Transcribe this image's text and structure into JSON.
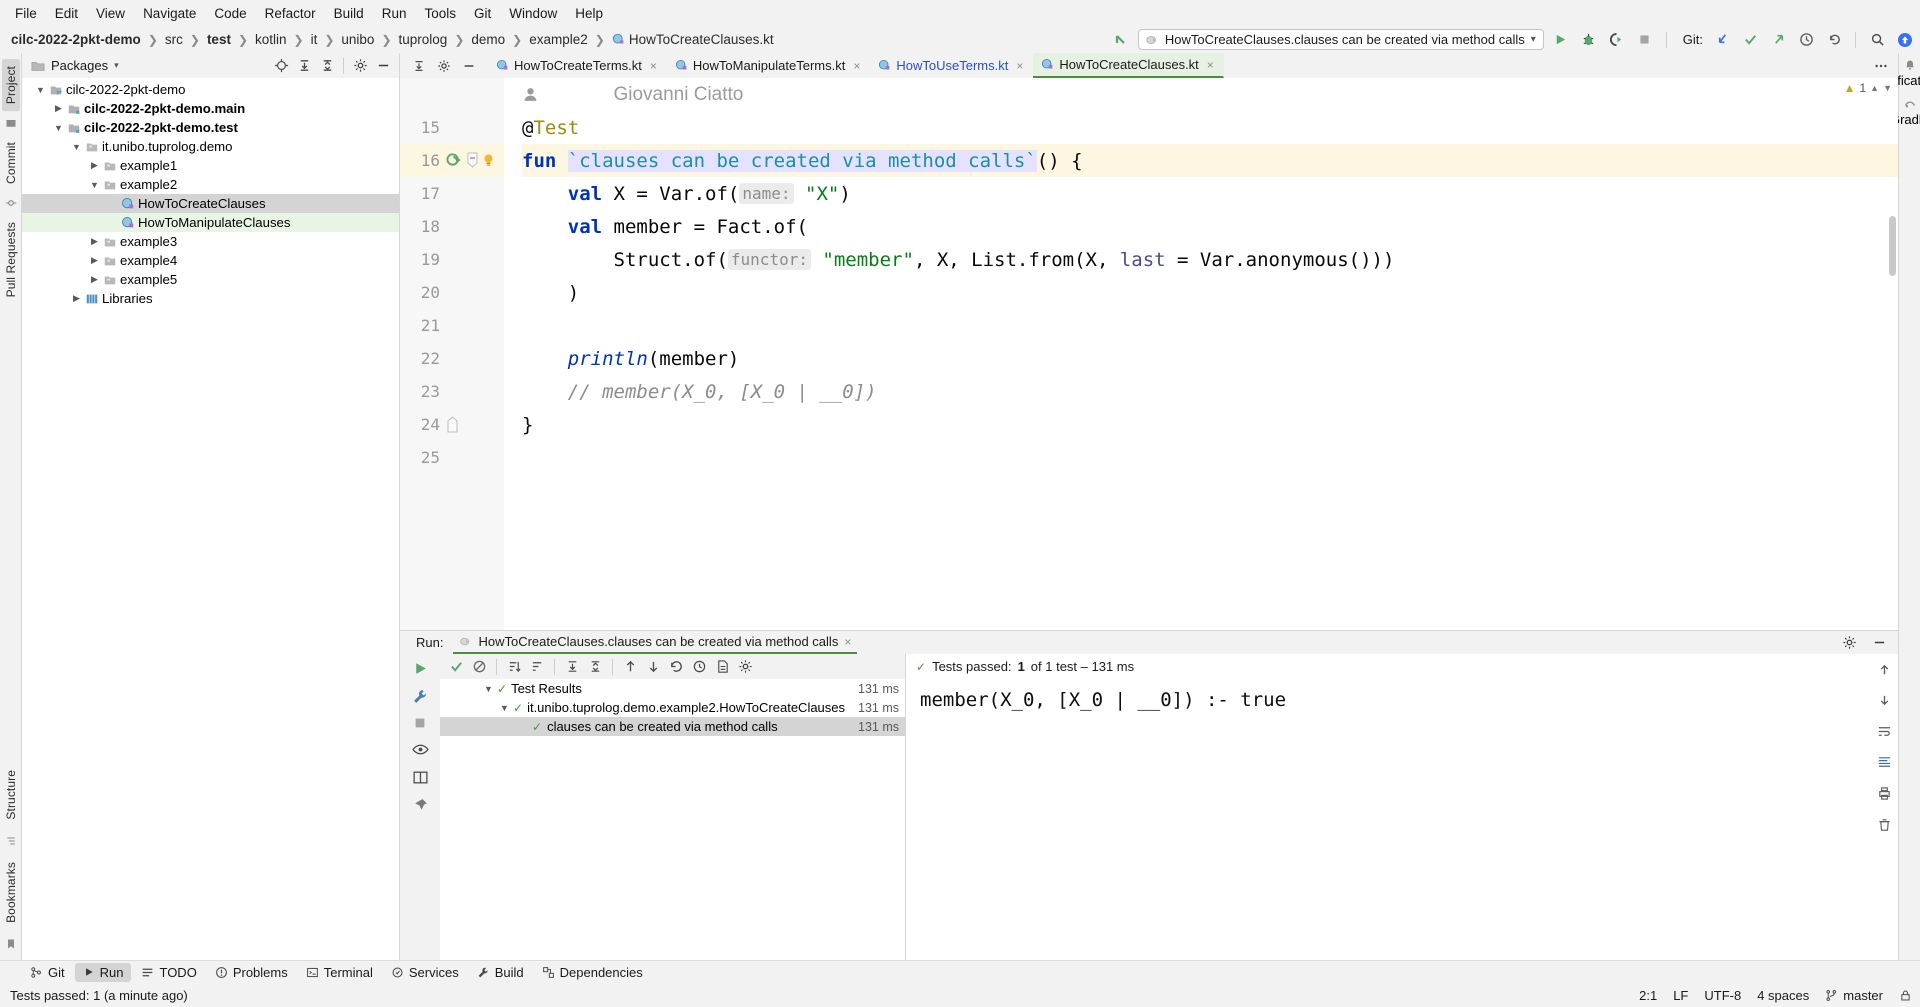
{
  "menu": {
    "items": [
      "File",
      "Edit",
      "View",
      "Navigate",
      "Code",
      "Refactor",
      "Build",
      "Run",
      "Tools",
      "Git",
      "Window",
      "Help"
    ]
  },
  "breadcrumb": {
    "items": [
      {
        "label": "cilc-2022-2pkt-demo",
        "bold": true,
        "icon": ""
      },
      {
        "label": "src",
        "bold": false,
        "icon": ""
      },
      {
        "label": "test",
        "bold": true,
        "icon": ""
      },
      {
        "label": "kotlin",
        "bold": false,
        "icon": ""
      },
      {
        "label": "it",
        "bold": false,
        "icon": ""
      },
      {
        "label": "unibo",
        "bold": false,
        "icon": ""
      },
      {
        "label": "tuprolog",
        "bold": false,
        "icon": ""
      },
      {
        "label": "demo",
        "bold": false,
        "icon": ""
      },
      {
        "label": "example2",
        "bold": false,
        "icon": ""
      },
      {
        "label": "HowToCreateClauses.kt",
        "bold": false,
        "icon": "kotlin-class-icon"
      }
    ],
    "separator": "❯"
  },
  "toolbar": {
    "run_config": "HowToCreateClauses.clauses can be created via method calls",
    "run_config_icon": "test-run-icon",
    "dropdown_glyph": "▾",
    "run_button": "run-icon",
    "debug_button": "debug-icon",
    "coverage_button": "run-with-coverage-icon",
    "stop_button": "stop-icon",
    "git_label": "Git:",
    "git_update": "update-project-icon",
    "git_commit": "commit-icon",
    "git_push": "push-icon",
    "history": "history-icon",
    "rollback": "rollback-icon",
    "search": "search-everywhere-icon",
    "updates": "ide-update-icon",
    "back_arrow": "back-arrow-icon"
  },
  "left_rail": {
    "top": [
      "Project",
      "Commit",
      "Pull Requests"
    ],
    "bottom": [
      "Bookmarks",
      "Structure"
    ],
    "selected": "Project"
  },
  "right_rail": {
    "items": [
      "Notifications",
      "Gradle"
    ]
  },
  "project_panel": {
    "title": "Packages",
    "title_icon": "packages-icon",
    "dropdown_glyph": "▾",
    "actions": [
      "locate-icon",
      "expand-all-icon",
      "collapse-all-icon",
      "settings-icon",
      "hide-icon"
    ],
    "tree": [
      {
        "depth": 0,
        "arrow": "down",
        "icon": "module-icon",
        "label": "cilc-2022-2pkt-demo",
        "bold": false,
        "state": "none"
      },
      {
        "depth": 1,
        "arrow": "right",
        "icon": "source-icon",
        "label": "cilc-2022-2pkt-demo.main",
        "bold": true,
        "state": "none"
      },
      {
        "depth": 1,
        "arrow": "down",
        "icon": "source-icon",
        "label": "cilc-2022-2pkt-demo.test",
        "bold": true,
        "state": "none"
      },
      {
        "depth": 2,
        "arrow": "down",
        "icon": "package-icon",
        "label": "it.unibo.tuprolog.demo",
        "bold": false,
        "state": "none"
      },
      {
        "depth": 3,
        "arrow": "right",
        "icon": "package-icon",
        "label": "example1",
        "bold": false,
        "state": "none"
      },
      {
        "depth": 3,
        "arrow": "down",
        "icon": "package-icon",
        "label": "example2",
        "bold": false,
        "state": "none"
      },
      {
        "depth": 4,
        "arrow": "none",
        "icon": "kotlin-class-icon",
        "label": "HowToCreateClauses",
        "bold": false,
        "state": "sel-gray"
      },
      {
        "depth": 4,
        "arrow": "none",
        "icon": "kotlin-class-icon",
        "label": "HowToManipulateClauses",
        "bold": false,
        "state": "sel-green"
      },
      {
        "depth": 3,
        "arrow": "right",
        "icon": "package-icon",
        "label": "example3",
        "bold": false,
        "state": "none"
      },
      {
        "depth": 3,
        "arrow": "right",
        "icon": "package-icon",
        "label": "example4",
        "bold": false,
        "state": "none"
      },
      {
        "depth": 3,
        "arrow": "right",
        "icon": "package-icon",
        "label": "example5",
        "bold": false,
        "state": "none"
      },
      {
        "depth": 1,
        "arrow": "right",
        "icon": "library-icon",
        "label": "Libraries",
        "bold": false,
        "state": "none"
      }
    ]
  },
  "editor": {
    "tabs": [
      {
        "label": "HowToCreateTerms.kt",
        "active": false,
        "blue": false
      },
      {
        "label": "HowToManipulateTerms.kt",
        "active": false,
        "blue": false
      },
      {
        "label": "HowToUseTerms.kt",
        "active": false,
        "blue": true
      },
      {
        "label": "HowToCreateClauses.kt",
        "active": true,
        "blue": false
      }
    ],
    "close_glyph": "×",
    "inspection_count": "1",
    "inspection_glyph": "⚠",
    "author_annotation": "Giovanni Ciatto",
    "lines": [
      {
        "num": "",
        "highlight": false,
        "gutter": [],
        "type": "author",
        "text": "Giovanni Ciatto"
      },
      {
        "num": "15",
        "highlight": false,
        "gutter": [],
        "type": "code",
        "tokens": [
          {
            "t": "@",
            "c": "plain"
          },
          {
            "t": "Test",
            "c": "ann"
          }
        ]
      },
      {
        "num": "16",
        "highlight": true,
        "gutter": [
          "run-test-gutter-icon",
          "fold-icon",
          "bulb-icon"
        ],
        "type": "code",
        "tokens": [
          {
            "t": "fun ",
            "c": "kw"
          },
          {
            "t": "`clauses can be created via method calls`",
            "c": "fname sel"
          },
          {
            "t": "() {",
            "c": "plain"
          }
        ]
      },
      {
        "num": "17",
        "highlight": false,
        "gutter": [],
        "type": "code",
        "tokens": [
          {
            "t": "    ",
            "c": "plain"
          },
          {
            "t": "val ",
            "c": "kw"
          },
          {
            "t": "X = Var.of(",
            "c": "plain"
          },
          {
            "t": "name:",
            "c": "hint"
          },
          {
            "t": " ",
            "c": "plain"
          },
          {
            "t": "\"X\"",
            "c": "str"
          },
          {
            "t": ")",
            "c": "plain"
          }
        ]
      },
      {
        "num": "18",
        "highlight": false,
        "gutter": [],
        "type": "code",
        "tokens": [
          {
            "t": "    ",
            "c": "plain"
          },
          {
            "t": "val ",
            "c": "kw"
          },
          {
            "t": "member = Fact.of(",
            "c": "plain"
          }
        ]
      },
      {
        "num": "19",
        "highlight": false,
        "gutter": [],
        "type": "code",
        "tokens": [
          {
            "t": "        Struct.of(",
            "c": "plain"
          },
          {
            "t": "functor:",
            "c": "hint"
          },
          {
            "t": " ",
            "c": "plain"
          },
          {
            "t": "\"member\"",
            "c": "str"
          },
          {
            "t": ", X, List.from(X, ",
            "c": "plain"
          },
          {
            "t": "last",
            "c": "hintplain"
          },
          {
            "t": " = Var.anonymous()))",
            "c": "plain"
          }
        ]
      },
      {
        "num": "20",
        "highlight": false,
        "gutter": [],
        "type": "code",
        "tokens": [
          {
            "t": "    )",
            "c": "plain"
          }
        ]
      },
      {
        "num": "21",
        "highlight": false,
        "gutter": [],
        "type": "code",
        "tokens": []
      },
      {
        "num": "22",
        "highlight": false,
        "gutter": [],
        "type": "code",
        "tokens": [
          {
            "t": "    ",
            "c": "plain"
          },
          {
            "t": "println",
            "c": "fnitalic"
          },
          {
            "t": "(member)",
            "c": "plain"
          }
        ]
      },
      {
        "num": "23",
        "highlight": false,
        "gutter": [],
        "type": "code",
        "tokens": [
          {
            "t": "    // member(X_0, [X_0 | __0])",
            "c": "cmt"
          }
        ]
      },
      {
        "num": "24",
        "highlight": false,
        "gutter": [
          "fold-end-icon"
        ],
        "type": "code",
        "tokens": [
          {
            "t": "}",
            "c": "plain"
          }
        ]
      },
      {
        "num": "25",
        "highlight": false,
        "gutter": [],
        "type": "code",
        "tokens": []
      }
    ]
  },
  "run_panel": {
    "label": "Run:",
    "tab_title": "HowToCreateClauses.clauses can be created via method calls",
    "tab_icon": "test-run-icon",
    "close_glyph": "×",
    "settings_icon": "settings-icon",
    "hide_icon": "hide-icon",
    "side_tools": [
      "rerun-icon",
      "wrench-icon",
      "stop-icon",
      "eye-icon",
      "layout-icon",
      "pin-icon"
    ],
    "tests_toolbar": [
      "show-passed-icon",
      "ignore-icon",
      "sort-alpha-icon",
      "sort-duration-icon",
      "expand-all-icon",
      "collapse-all-icon",
      "prev-test-icon",
      "next-test-icon",
      "rerun-failed-icon",
      "history-icon",
      "export-icon",
      "settings-icon"
    ],
    "summary_check": "✓",
    "summary_prefix": "Tests passed:",
    "summary_count": "1",
    "summary_rest": "of 1 test – 131 ms",
    "tests": [
      {
        "depth": 0,
        "arrow": "down",
        "label": "Test Results",
        "duration": "131 ms",
        "selected": false
      },
      {
        "depth": 1,
        "arrow": "down",
        "label": "it.unibo.tuprolog.demo.example2.HowToCreateClauses",
        "duration": "131 ms",
        "selected": false
      },
      {
        "depth": 2,
        "arrow": "none",
        "label": "clauses can be created via method calls",
        "duration": "131 ms",
        "selected": true
      }
    ],
    "console_output": "member(X_0, [X_0 | __0]) :- true",
    "console_side_icons": [
      "scroll-up-icon",
      "scroll-down-icon",
      "soft-wrap-icon",
      "scroll-end-icon",
      "print-icon",
      "clear-all-icon"
    ]
  },
  "bottom_toolbar": {
    "items": [
      {
        "label": "Git",
        "icon": "git-icon",
        "active": false
      },
      {
        "label": "Run",
        "icon": "run-icon",
        "active": true
      },
      {
        "label": "TODO",
        "icon": "todo-icon",
        "active": false
      },
      {
        "label": "Problems",
        "icon": "problems-icon",
        "active": false
      },
      {
        "label": "Terminal",
        "icon": "terminal-icon",
        "active": false
      },
      {
        "label": "Services",
        "icon": "services-icon",
        "active": false
      },
      {
        "label": "Build",
        "icon": "build-icon",
        "active": false
      },
      {
        "label": "Dependencies",
        "icon": "dependencies-icon",
        "active": false
      }
    ]
  },
  "statusbar": {
    "message": "Tests passed: 1 (a minute ago)",
    "caret": "2:1",
    "line_separator": "LF",
    "encoding": "UTF-8",
    "indent": "4 spaces",
    "branch": "master",
    "branch_icon": "branch-icon",
    "lock_icon": "lock-icon"
  }
}
